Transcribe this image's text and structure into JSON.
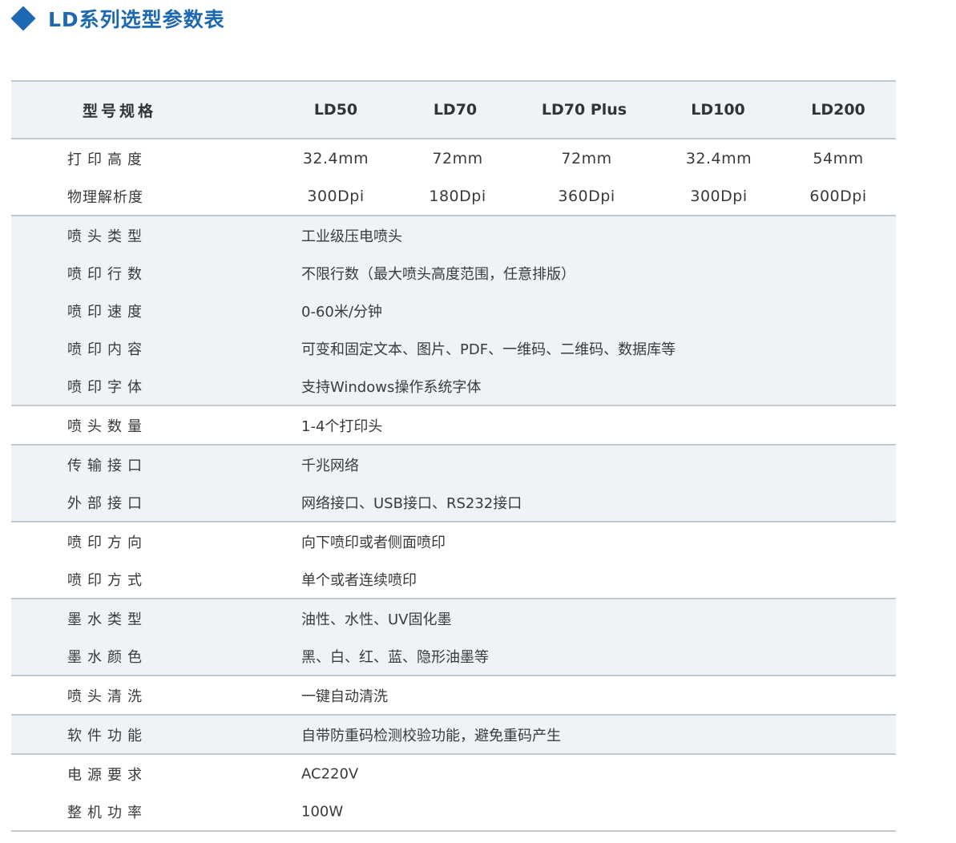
{
  "title": "LD系列选型参数表",
  "colors": {
    "accent": "#1d68b2",
    "row_shade": "#eef3f8",
    "rule": "#c6c9cc"
  },
  "header": {
    "label": "型号规格",
    "models": [
      "LD50",
      "LD70",
      "LD70 Plus",
      "LD100",
      "LD200"
    ]
  },
  "model_rows": [
    {
      "label": "打印高度",
      "values": [
        "32.4mm",
        "72mm",
        "72mm",
        "32.4mm",
        "54mm"
      ]
    },
    {
      "label": "物理解析度",
      "values": [
        "300Dpi",
        "180Dpi",
        "360Dpi",
        "300Dpi",
        "600Dpi"
      ]
    }
  ],
  "groups": [
    [
      {
        "label": "喷头类型",
        "value": "工业级压电喷头"
      },
      {
        "label": "喷印行数",
        "value": "不限行数（最大喷头高度范围，任意排版）"
      },
      {
        "label": "喷印速度",
        "value": "0-60米/分钟"
      },
      {
        "label": "喷印内容",
        "value": "可变和固定文本、图片、PDF、一维码、二维码、数据库等"
      },
      {
        "label": "喷印字体",
        "value": "支持Windows操作系统字体"
      }
    ],
    [
      {
        "label": "喷头数量",
        "value": "1-4个打印头"
      }
    ],
    [
      {
        "label": "传输接口",
        "value": "千兆网络"
      },
      {
        "label": "外部接口",
        "value": "网络接口、USB接口、RS232接口"
      }
    ],
    [
      {
        "label": "喷印方向",
        "value": "向下喷印或者侧面喷印"
      },
      {
        "label": "喷印方式",
        "value": "单个或者连续喷印"
      }
    ],
    [
      {
        "label": "墨水类型",
        "value": "油性、水性、UV固化墨"
      },
      {
        "label": "墨水颜色",
        "value": "黑、白、红、蓝、隐形油墨等"
      }
    ],
    [
      {
        "label": "喷头清洗",
        "value": "一键自动清洗"
      }
    ],
    [
      {
        "label": "软件功能",
        "value": "自带防重码检测校验功能，避免重码产生"
      }
    ],
    [
      {
        "label": "电源要求",
        "value": "AC220V"
      },
      {
        "label": "整机功率",
        "value": "100W"
      }
    ]
  ]
}
